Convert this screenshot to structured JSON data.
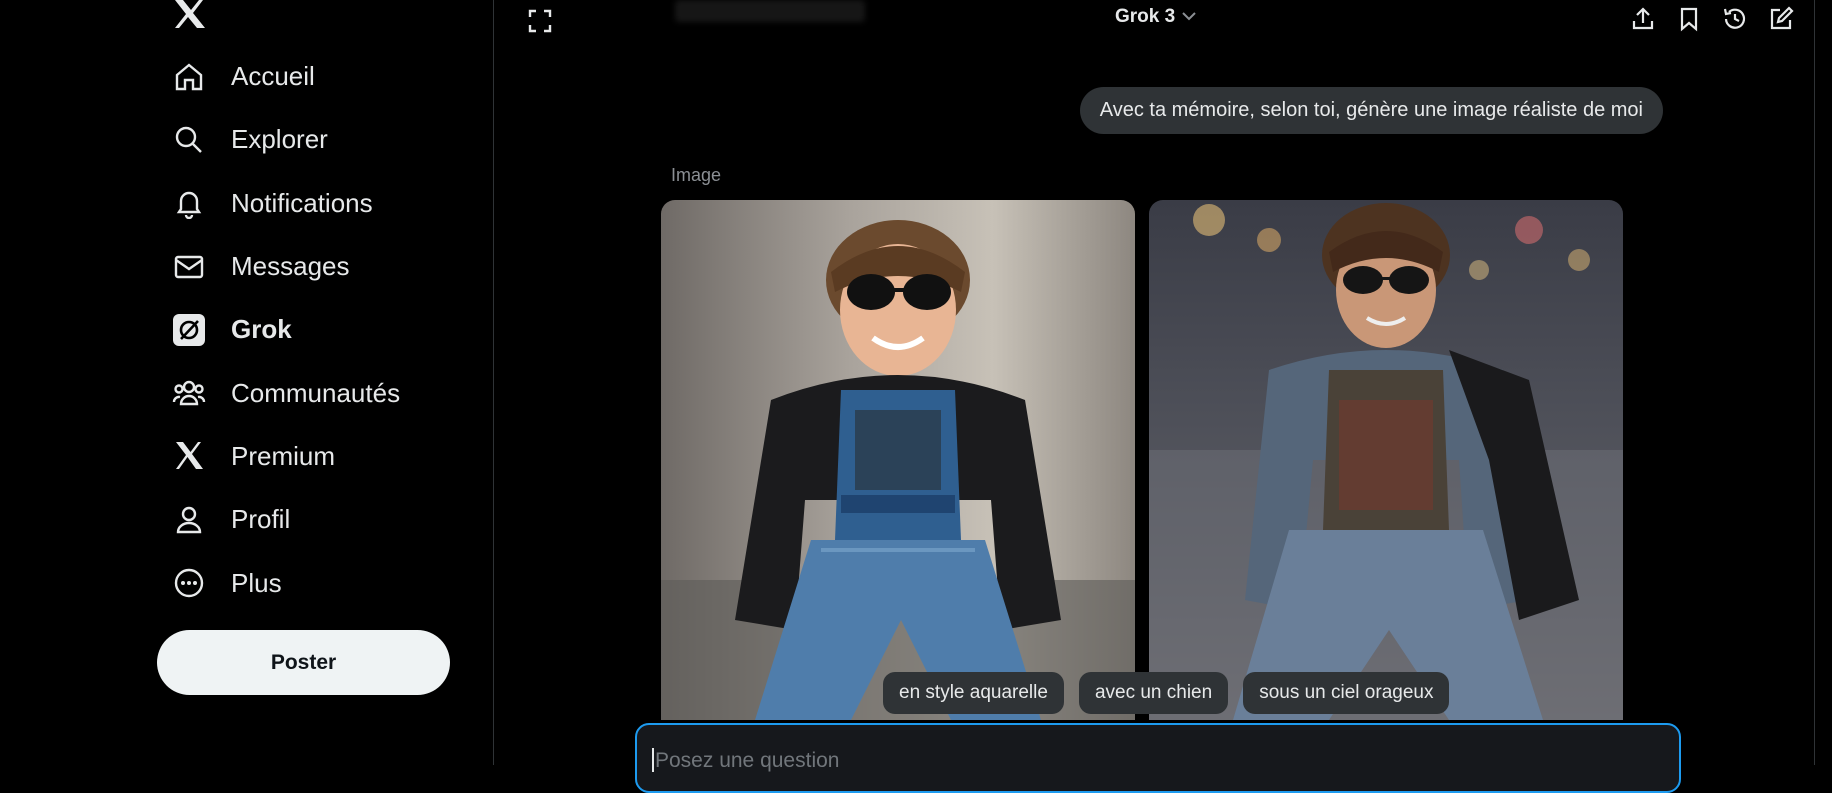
{
  "sidebar": {
    "items": [
      {
        "label": "Accueil",
        "icon": "home-icon"
      },
      {
        "label": "Explorer",
        "icon": "search-icon"
      },
      {
        "label": "Notifications",
        "icon": "bell-icon"
      },
      {
        "label": "Messages",
        "icon": "mail-icon"
      },
      {
        "label": "Grok",
        "icon": "grok-icon",
        "active": true
      },
      {
        "label": "Communautés",
        "icon": "communities-icon"
      },
      {
        "label": "Premium",
        "icon": "x-logo-icon"
      },
      {
        "label": "Profil",
        "icon": "person-icon"
      },
      {
        "label": "Plus",
        "icon": "more-circle-icon"
      }
    ],
    "post_label": "Poster"
  },
  "header": {
    "model": "Grok 3",
    "actions": [
      "share-icon",
      "bookmark-icon",
      "history-icon",
      "new-chat-icon"
    ]
  },
  "chat": {
    "user_message": "Avec ta mémoire, selon toi, génère une image réaliste de moi",
    "image_label": "Image",
    "suggestions": [
      "en style aquarelle",
      "avec un chien",
      "sous un ciel orageux"
    ]
  },
  "composer": {
    "placeholder": "Posez une question"
  },
  "colors": {
    "background": "#000000",
    "text": "#e7e9ea",
    "bubble": "#2f3336",
    "accent": "#1d9bf0",
    "post_button": "#eff3f4"
  }
}
